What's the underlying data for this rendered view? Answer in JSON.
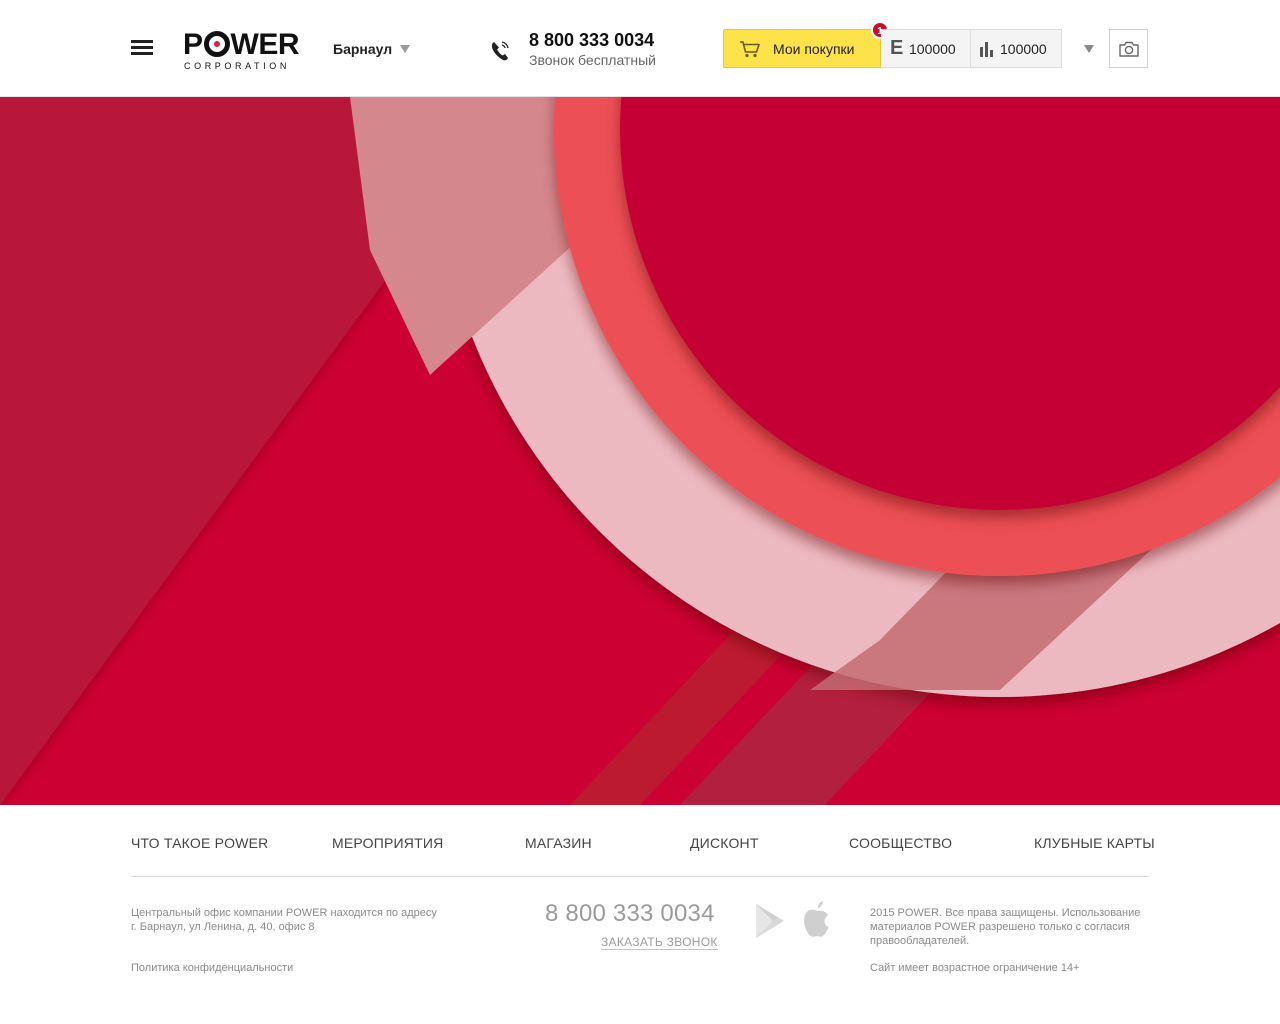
{
  "header": {
    "logo_text": "POWER",
    "logo_subtitle": "CORPORATION",
    "city": "Барнаул",
    "phone": "8 800 333 0034",
    "phone_note": "Звонок бесплатный",
    "cart_label": "Мои покупки",
    "cart_badge": "1",
    "balance_e": "100000",
    "balance_points": "100000"
  },
  "page_load_progress": 0.255,
  "colors": {
    "brand_red": "#cc0033",
    "cart_yellow": "#fee24a",
    "badge_red": "#c8102e"
  },
  "icons": [
    "menu-icon",
    "phone-icon",
    "cart-icon",
    "e-currency-icon",
    "bar-chart-icon",
    "chevron-down-icon",
    "camera-icon",
    "google-play-icon",
    "apple-icon"
  ],
  "footer": {
    "nav": [
      "ЧТО ТАКОЕ POWER",
      "МЕРОПРИЯТИЯ",
      "МАГАЗИН",
      "ДИСКОНТ",
      "СООБЩЕСТВО",
      "КЛУБНЫЕ КАРТЫ"
    ],
    "address_line1": "Центральный офис компании POWER находится по адресу",
    "address_line2": "г. Барнаул, ул Ленина, д. 40, офис 8",
    "privacy": "Политика конфиденциальности",
    "phone": "8 800 333 0034",
    "callback": "ЗАКАЗАТЬ ЗВОНОК",
    "copyright": "2015 POWER. Все права защищены. Использование материалов POWER разрешено только с согласия правообладателей.",
    "age_notice": "Сайт имеет возрастное ограничение 14+"
  }
}
